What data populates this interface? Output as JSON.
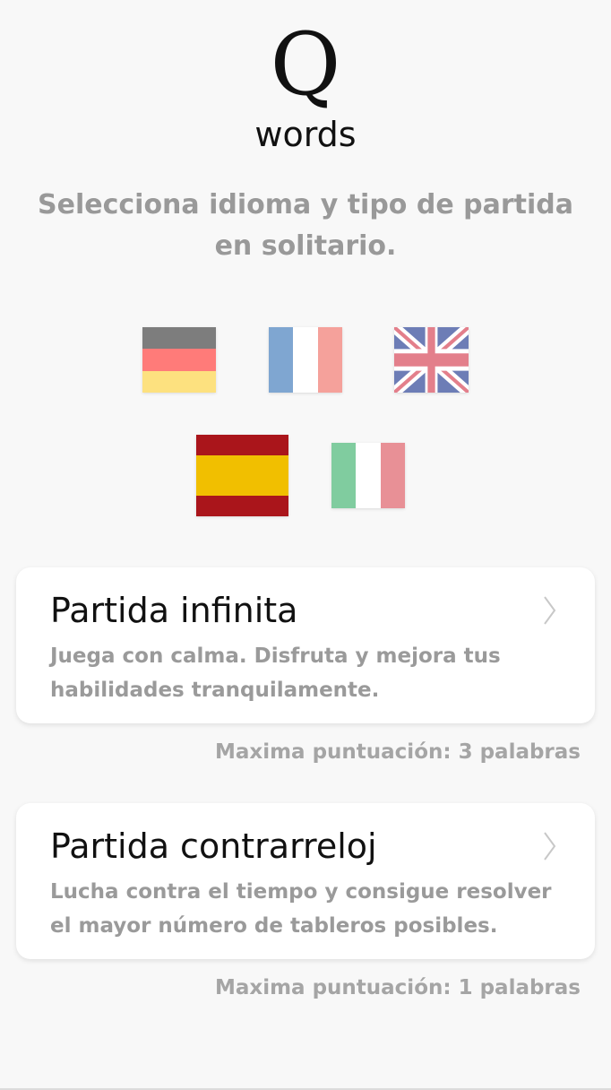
{
  "logo": {
    "letter": "Q",
    "word": "words"
  },
  "subtitle": "Selecciona idioma y tipo de partida en solitario.",
  "languages": [
    {
      "name": "german-flag",
      "colors": [
        "#7d7d7d",
        "#ff7b79",
        "#fde17f"
      ]
    },
    {
      "name": "french-flag",
      "colors": [
        "#7fa6d1",
        "#ffffff",
        "#f5a19b"
      ]
    },
    {
      "name": "uk-flag",
      "colors": [
        "#6d7db6",
        "#ffffff",
        "#e37f8b"
      ]
    },
    {
      "name": "spanish-flag",
      "colors": [
        "#aa151b",
        "#f1bf00",
        "#aa151b"
      ]
    },
    {
      "name": "italian-flag",
      "colors": [
        "#80cc9f",
        "#ffffff",
        "#e89096"
      ]
    }
  ],
  "modes": [
    {
      "title": "Partida infinita",
      "description": "Juega con calma. Disfruta y mejora tus habilidades tranquilamente.",
      "score": "Maxima puntuación: 3 palabras"
    },
    {
      "title": "Partida contrarreloj",
      "description": "Lucha contra el tiempo y consigue resolver el mayor número de tableros posibles.",
      "score": "Maxima puntuación: 1 palabras"
    }
  ]
}
